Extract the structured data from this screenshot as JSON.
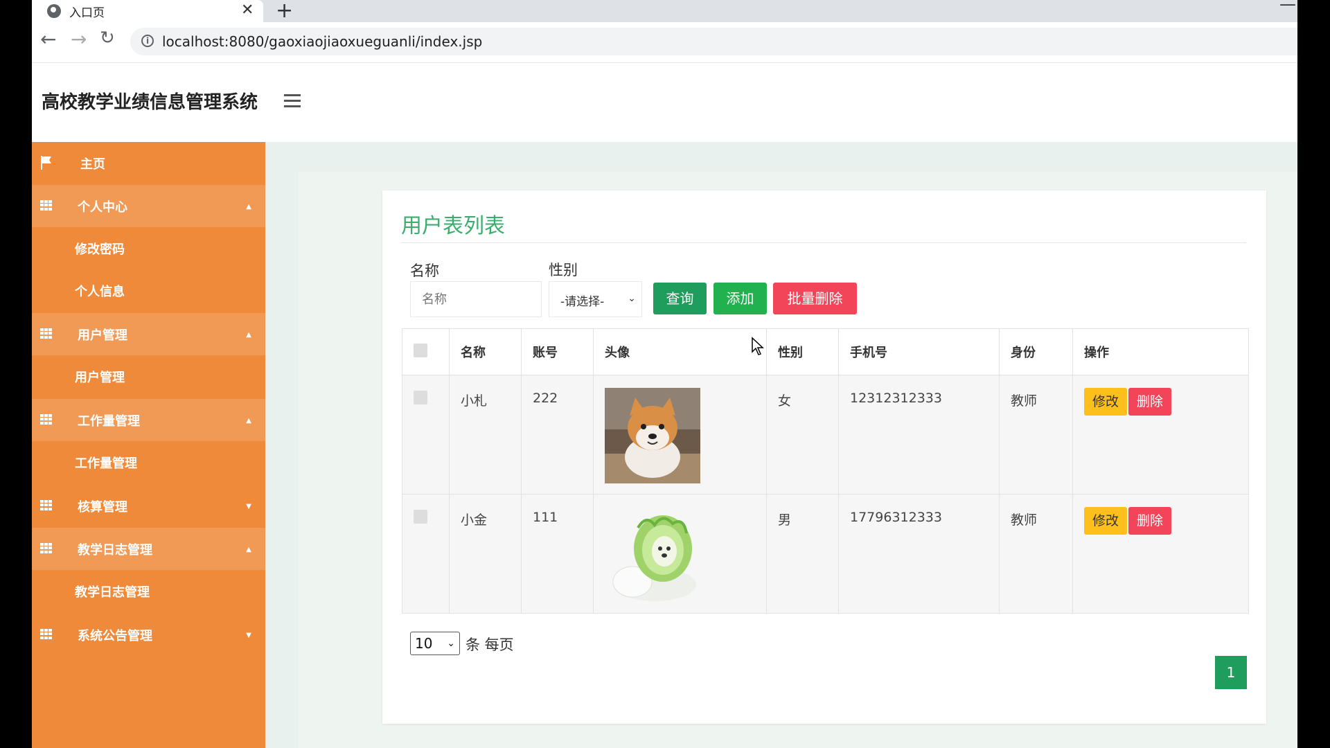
{
  "browser": {
    "tab_title": "入口页",
    "tab_close": "✕",
    "new_tab": "+",
    "minimize": "—",
    "url": "localhost:8080/gaoxiaojiaoxueguanli/index.jsp"
  },
  "header": {
    "title": "高校教学业绩信息管理系统"
  },
  "sidebar": {
    "items": [
      {
        "label": "主页",
        "type": "link",
        "icon": "flag-icon"
      },
      {
        "label": "个人中心",
        "type": "group",
        "icon": "grid-icon",
        "caret": "up"
      },
      {
        "label": "修改密码",
        "type": "sub"
      },
      {
        "label": "个人信息",
        "type": "sub"
      },
      {
        "label": "用户管理",
        "type": "group",
        "icon": "grid-icon",
        "caret": "up"
      },
      {
        "label": "用户管理",
        "type": "sub"
      },
      {
        "label": "工作量管理",
        "type": "group",
        "icon": "grid-icon",
        "caret": "up"
      },
      {
        "label": "工作量管理",
        "type": "sub"
      },
      {
        "label": "核算管理",
        "type": "group",
        "icon": "grid-icon",
        "caret": "down"
      },
      {
        "label": "教学日志管理",
        "type": "group",
        "icon": "grid-icon",
        "caret": "up"
      },
      {
        "label": "教学日志管理",
        "type": "sub"
      },
      {
        "label": "系统公告管理",
        "type": "group",
        "icon": "grid-icon",
        "caret": "down"
      }
    ]
  },
  "main": {
    "card_title": "用户表列表",
    "filters": {
      "name_label": "名称",
      "name_placeholder": "名称",
      "gender_label": "性别",
      "gender_selected": "-请选择-"
    },
    "buttons": {
      "query": "查询",
      "add": "添加",
      "bulk_delete": "批量删除"
    },
    "table": {
      "headers": [
        "名称",
        "账号",
        "头像",
        "性别",
        "手机号",
        "身份",
        "操作"
      ],
      "rows": [
        {
          "name": "小札",
          "account": "222",
          "avatar": "shiba-dog-photo",
          "gender": "女",
          "phone": "12312312333",
          "role": "教师",
          "edit": "修改",
          "delete": "删除"
        },
        {
          "name": "小金",
          "account": "111",
          "avatar": "cabbage-dog-image",
          "gender": "男",
          "phone": "17796312333",
          "role": "教师",
          "edit": "修改",
          "delete": "删除"
        }
      ]
    },
    "pagination": {
      "page_size": "10",
      "per_page_text": "条 每页",
      "current_page": "1"
    }
  },
  "colors": {
    "sidebar": "#ee8a3a",
    "sidebar_group": "#f09a55",
    "title_green": "#3cad6e",
    "query_green": "#1e9d5c",
    "add_green": "#22b14f",
    "danger": "#f2455a",
    "warning": "#fdbf1c"
  }
}
